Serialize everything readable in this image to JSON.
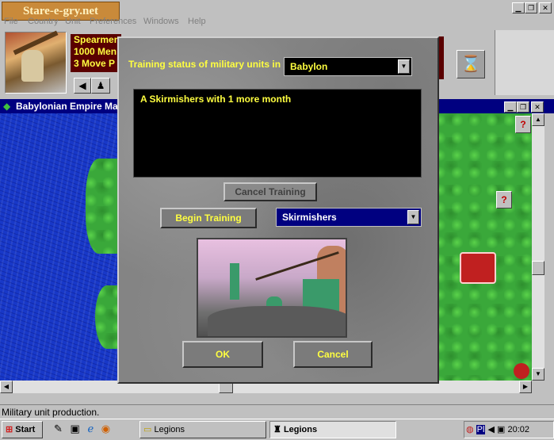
{
  "watermark": "Stare-e-gry.net",
  "menu": [
    "File",
    "Country",
    "Unit",
    "Preferences",
    "Windows",
    "Help"
  ],
  "unit_info": [
    "Spearmen",
    "1000 Men",
    "3 Move P"
  ],
  "map_window": {
    "title": "Babylonian Empire Map"
  },
  "dialog": {
    "training_label": "Training status of military units in",
    "city_select": "Babylon",
    "status_lines": [
      "A Skirmishers with 1 more month"
    ],
    "cancel_training": "Cancel Training",
    "begin_training": "Begin Training",
    "unit_select": "Skirmishers",
    "ok": "OK",
    "cancel": "Cancel"
  },
  "map_markers": [
    "?",
    "?"
  ],
  "status_bar": "Military unit production.",
  "taskbar": {
    "start": "Start",
    "tasks": [
      "Legions",
      "Legions"
    ],
    "tray_lang": "Pl",
    "clock": "20:02"
  },
  "colors": {
    "dialog_text": "#ffff40",
    "title_bar": "#000080",
    "sea": "#1838c8",
    "land": "#3aa83a"
  }
}
